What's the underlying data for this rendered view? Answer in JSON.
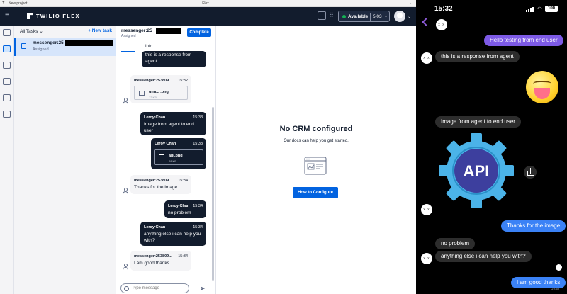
{
  "titlebar": {
    "new_project": "New project",
    "title": "Flex"
  },
  "topnav": {
    "brand": "TWILIO FLEX",
    "status": "Available",
    "timer": "5:03"
  },
  "task_list": {
    "filter": "All Tasks",
    "new_task": "+ New task",
    "tasks": [
      {
        "name": "messenger:25",
        "status": "Assigned"
      }
    ]
  },
  "chat": {
    "title": "messenger:25",
    "subtitle": "Assigned",
    "complete": "Complete",
    "info_tab": "Info",
    "composer_placeholder": "Type message",
    "messages": [
      {
        "from": "agent",
        "text": "this is a response from agent"
      },
      {
        "from": "customer",
        "sender": "messenger:253809...",
        "time": "15:32",
        "file_name": "unn... .png",
        "file_size": "12 KB"
      },
      {
        "from": "agent",
        "sender": "Leroy Chan",
        "time": "15:33",
        "text": "Image from agent to end user"
      },
      {
        "from": "agent",
        "sender": "Leroy Chan",
        "time": "15:33",
        "file_name": "api.png",
        "file_size": "28 KB"
      },
      {
        "from": "customer",
        "sender": "messenger:253809...",
        "time": "15:34",
        "text": "Thanks for the image"
      },
      {
        "from": "agent",
        "sender": "Leroy Chan",
        "time": "15:34",
        "text": "no problem"
      },
      {
        "from": "agent",
        "sender": "Leroy Chan",
        "time": "15:34",
        "text": "anything else i can help you with?"
      },
      {
        "from": "customer",
        "sender": "messenger:253809...",
        "time": "15:34",
        "text": "I am good thanks"
      }
    ]
  },
  "crm": {
    "title": "No CRM configured",
    "subtitle": "Our docs can help you get started.",
    "button": "How to Configure"
  },
  "phone": {
    "time": "15:32",
    "battery": "100",
    "avatar_initials": "x x",
    "messages": [
      {
        "dir": "out",
        "text": "Hello testing from end user"
      },
      {
        "dir": "in",
        "text": "this is a response from agent"
      },
      {
        "dir": "in",
        "text": "Image from agent to end user"
      },
      {
        "dir": "out",
        "text": "Thanks for the image"
      },
      {
        "dir": "in",
        "text": "no problem"
      },
      {
        "dir": "in",
        "text": "anything else i can help you with?"
      },
      {
        "dir": "out",
        "text": "I am good thanks"
      }
    ],
    "api_image_label": "API",
    "read_receipt": "Read"
  },
  "colors": {
    "flex_navy": "#121c2d",
    "flex_blue": "#0263e0",
    "imessage_blue": "#3b82f6",
    "imessage_purple": "#7d5ae6",
    "gear_blue": "#4bb3e8",
    "gear_center": "#3d3f9e"
  }
}
